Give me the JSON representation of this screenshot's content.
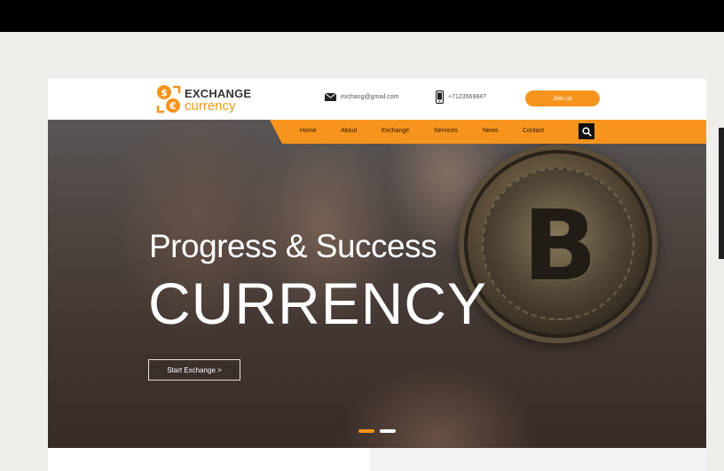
{
  "colors": {
    "accent": "#f7941d",
    "header_bg": "#ffffff",
    "dark": "#111111"
  },
  "header": {
    "logo": {
      "icon": "currency-exchange-icon",
      "line1": "EXCHANGE",
      "line2": "currency"
    },
    "email": {
      "icon": "mail-icon",
      "text": "exchang@gmail.com"
    },
    "phone": {
      "icon": "phone-icon",
      "text": "+7123569847"
    },
    "join_label": "Join us"
  },
  "nav": {
    "items": [
      {
        "label": "Home"
      },
      {
        "label": "About"
      },
      {
        "label": "Exchange"
      },
      {
        "label": "Services"
      },
      {
        "label": "News"
      },
      {
        "label": "Contact"
      }
    ],
    "search_icon": "search-icon"
  },
  "hero": {
    "subtitle": "Progress & Success",
    "title": "CURRENCY",
    "cta_label": "Start Exchange >",
    "image": "bitcoin-coin-in-hand",
    "slider": {
      "total": 2,
      "active": 1
    }
  }
}
